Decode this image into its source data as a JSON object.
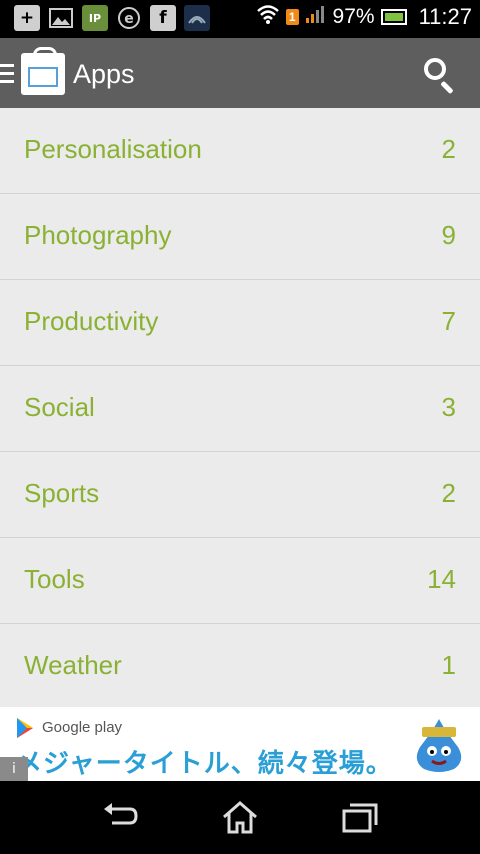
{
  "status_bar": {
    "battery_percent": "97%",
    "time": "11:27",
    "notification_badge": "1",
    "notification_icons": [
      "add-icon",
      "image-icon",
      "ip-call-icon",
      "e-icon",
      "facebook-icon",
      "signal-app-icon"
    ]
  },
  "action_bar": {
    "title": "Apps"
  },
  "categories": [
    {
      "label": "Personalisation",
      "count": "2"
    },
    {
      "label": "Photography",
      "count": "9"
    },
    {
      "label": "Productivity",
      "count": "7"
    },
    {
      "label": "Social",
      "count": "3"
    },
    {
      "label": "Sports",
      "count": "2"
    },
    {
      "label": "Tools",
      "count": "14"
    },
    {
      "label": "Weather",
      "count": "1"
    }
  ],
  "ad": {
    "brand": "Google play",
    "headline": "メジャータイトル、続々登場。",
    "info_icon": "i"
  },
  "colors": {
    "accent_green": "#8ab133",
    "action_bar": "#5e5e5e",
    "list_bg": "#ebebeb"
  }
}
